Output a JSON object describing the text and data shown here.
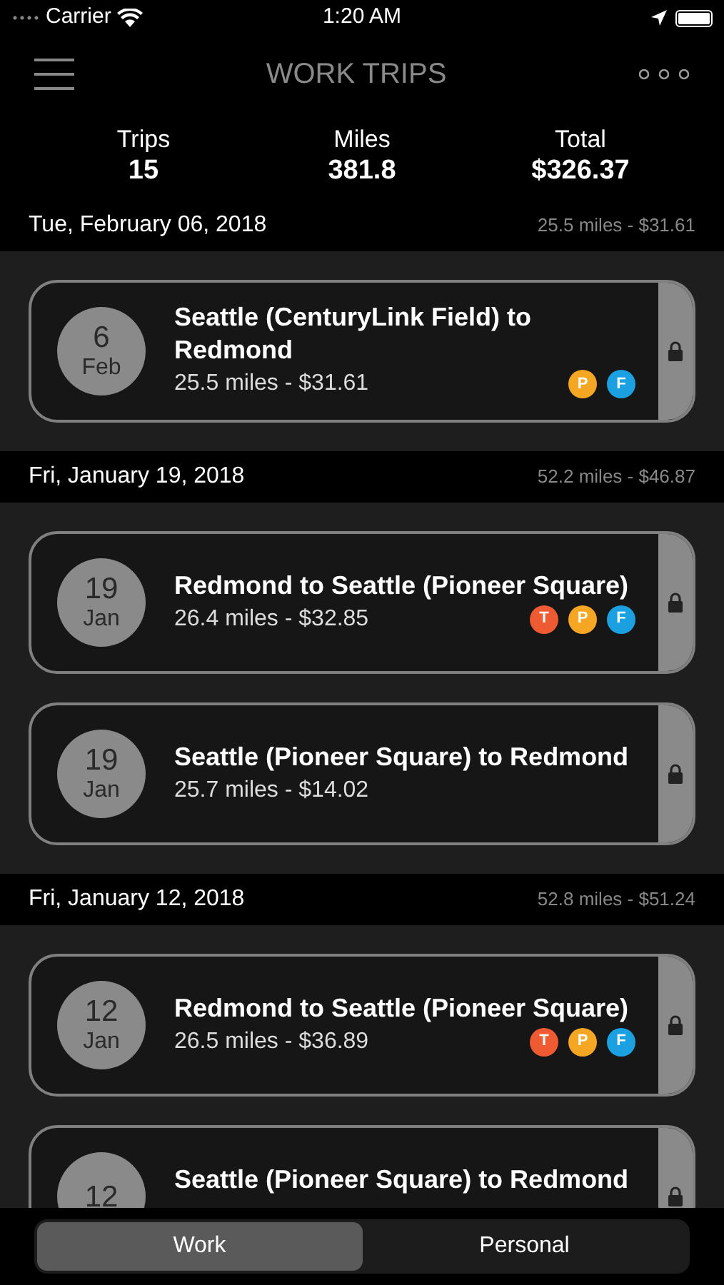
{
  "status_bar": {
    "carrier": "Carrier",
    "time": "1:20 AM"
  },
  "nav": {
    "title": "WORK TRIPS"
  },
  "summary": [
    {
      "label": "Trips",
      "value": "15"
    },
    {
      "label": "Miles",
      "value": "381.8"
    },
    {
      "label": "Total",
      "value": "$326.37"
    }
  ],
  "groups": [
    {
      "date": "Tue, February 06, 2018",
      "total": "25.5 miles - $31.61",
      "trips": [
        {
          "day": "6",
          "month": "Feb",
          "route": "Seattle (CenturyLink Field) to Redmond",
          "detail": "25.5 miles - $31.61",
          "tags": [
            {
              "letter": "P",
              "color": "#f5a623"
            },
            {
              "letter": "F",
              "color": "#1ba1e2"
            }
          ]
        }
      ]
    },
    {
      "date": "Fri, January 19, 2018",
      "total": "52.2 miles - $46.87",
      "trips": [
        {
          "day": "19",
          "month": "Jan",
          "route": "Redmond to Seattle (Pioneer Square)",
          "detail": "26.4 miles - $32.85",
          "tags": [
            {
              "letter": "T",
              "color": "#ef5a33"
            },
            {
              "letter": "P",
              "color": "#f5a623"
            },
            {
              "letter": "F",
              "color": "#1ba1e2"
            }
          ]
        },
        {
          "day": "19",
          "month": "Jan",
          "route": "Seattle (Pioneer Square) to Redmond",
          "detail": "25.7 miles - $14.02"
        }
      ]
    },
    {
      "date": "Fri, January 12, 2018",
      "total": "52.8 miles - $51.24",
      "trips": [
        {
          "day": "12",
          "month": "Jan",
          "route": "Redmond to Seattle (Pioneer Square)",
          "detail": "26.5 miles - $36.89",
          "tags": [
            {
              "letter": "T",
              "color": "#ef5a33"
            },
            {
              "letter": "P",
              "color": "#f5a623"
            },
            {
              "letter": "F",
              "color": "#1ba1e2"
            }
          ]
        },
        {
          "day": "12",
          "route": "Seattle (Pioneer Square) to Redmond"
        }
      ]
    }
  ],
  "tabs": [
    {
      "label": "Work",
      "selected": true
    },
    {
      "label": "Personal",
      "selected": false
    }
  ]
}
